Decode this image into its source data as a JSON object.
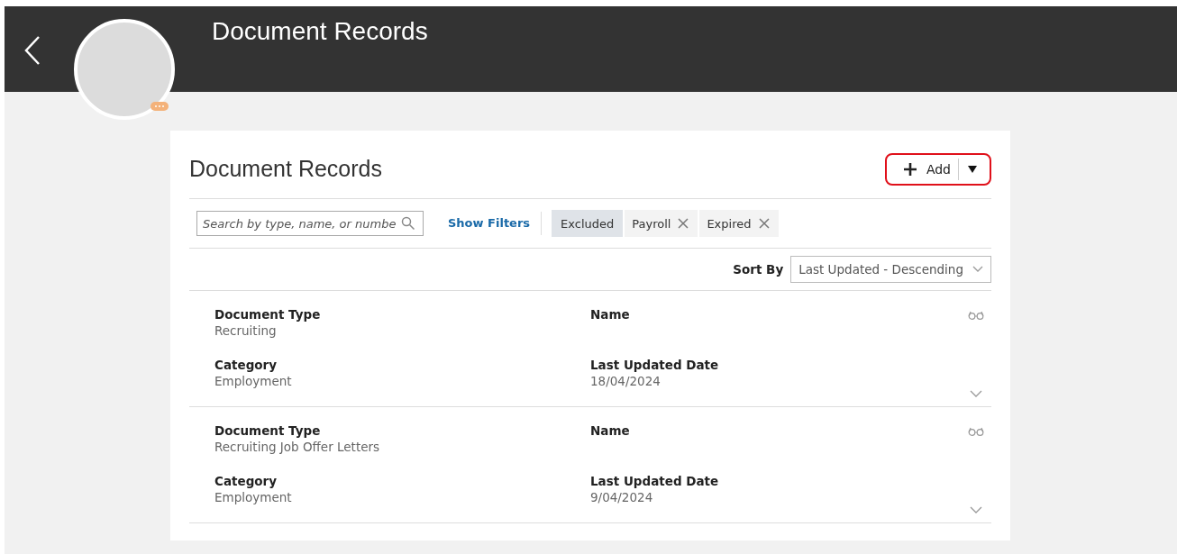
{
  "header": {
    "title": "Document Records",
    "avatar_badge": true
  },
  "panel": {
    "title": "Document Records",
    "add_button": {
      "label": "Add",
      "highlighted": true
    },
    "search": {
      "placeholder": "Search by type, name, or numbe"
    },
    "show_filters": "Show Filters",
    "chips": [
      {
        "label": "Excluded",
        "kind": "label"
      },
      {
        "label": "Payroll",
        "kind": "removable"
      },
      {
        "label": "Expired",
        "kind": "removable"
      }
    ],
    "sort": {
      "label": "Sort By",
      "value": "Last Updated - Descending"
    },
    "records": [
      {
        "fields": [
          {
            "label": "Document Type",
            "value": "Recruiting"
          },
          {
            "label": "Name"
          },
          {
            "label": "Category",
            "value": "Employment"
          },
          {
            "label": "Last Updated Date",
            "value": "18/04/2024"
          }
        ]
      },
      {
        "fields": [
          {
            "label": "Document Type",
            "value": "Recruiting Job Offer Letters"
          },
          {
            "label": "Name"
          },
          {
            "label": "Category",
            "value": "Employment"
          },
          {
            "label": "Last Updated Date",
            "value": "9/04/2024"
          }
        ]
      }
    ]
  }
}
